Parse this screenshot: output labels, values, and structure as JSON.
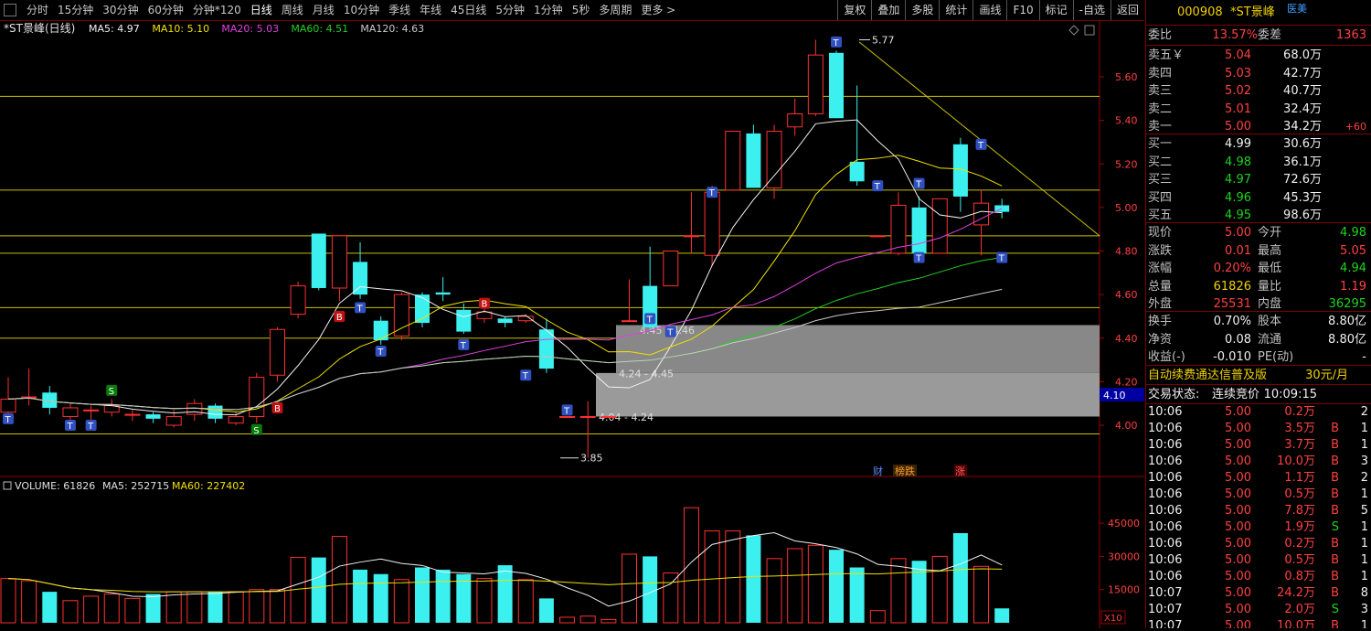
{
  "toolbar": {
    "tabs": [
      {
        "label": "分时",
        "active": false
      },
      {
        "label": "15分钟",
        "active": false
      },
      {
        "label": "30分钟",
        "active": false
      },
      {
        "label": "60分钟",
        "active": false
      },
      {
        "label": "分钟*120",
        "active": false
      },
      {
        "label": "日线",
        "active": true
      },
      {
        "label": "周线",
        "active": false
      },
      {
        "label": "月线",
        "active": false
      },
      {
        "label": "10分钟",
        "active": false
      },
      {
        "label": "季线",
        "active": false
      },
      {
        "label": "年线",
        "active": false
      },
      {
        "label": "45日线",
        "active": false
      },
      {
        "label": "5分钟",
        "active": false
      },
      {
        "label": "1分钟",
        "active": false
      },
      {
        "label": "5秒",
        "active": false
      },
      {
        "label": "多周期",
        "active": false
      },
      {
        "label": "更多 >",
        "active": false
      }
    ],
    "tools": [
      "复权",
      "叠加",
      "多股",
      "统计",
      "画线",
      "F10",
      "标记",
      "-自选",
      "返回"
    ]
  },
  "chart": {
    "title": "*ST景峰(日线)",
    "ma_labels": [
      {
        "text": "MA5: 4.97",
        "color": "#f0f0f0"
      },
      {
        "text": "MA10: 5.10",
        "color": "#f0e000"
      },
      {
        "text": "MA20: 5.03",
        "color": "#e040e0"
      },
      {
        "text": "MA60: 4.51",
        "color": "#20d020"
      },
      {
        "text": "MA120: 4.63",
        "color": "#c8c8c8"
      }
    ],
    "price_ticks": [
      "5.60",
      "5.40",
      "5.20",
      "5.00",
      "4.80",
      "4.60",
      "4.40",
      "4.20",
      "4.00"
    ],
    "current_price_tag": "4.10",
    "annotations": {
      "high": "5.77",
      "low": "3.85",
      "zone1": "4.45 - 4.46",
      "zone2": "4.24 - 4.45",
      "zone3": "4.04 - 4.24"
    },
    "markers": {
      "cai": "财",
      "bang": "榜跌",
      "zhang": "涨"
    },
    "signal_t": "T",
    "signal_b": "B",
    "signal_s": "S",
    "volume_title": "VOLUME: 61826",
    "volume_ma5": "MA5: 252715",
    "volume_ma60": "MA60: 227402",
    "volume_ticks": [
      "45000",
      "30000",
      "15000"
    ],
    "volume_unit": "X10",
    "colors": {
      "up": "#ff3030",
      "down": "#3cf0f0",
      "ma5": "#f0f0f0",
      "ma10": "#f0e000",
      "ma20": "#e040e0",
      "ma60": "#20d020",
      "ma120": "#c8c8c8",
      "zone": "#888888"
    }
  },
  "chart_data": {
    "type": "candlestick",
    "title": "*ST景峰(日线)",
    "candles": [
      {
        "o": 4.06,
        "c": 4.12,
        "h": 4.22,
        "l": 4.01
      },
      {
        "o": 4.13,
        "c": 4.13,
        "h": 4.26,
        "l": 4.09
      },
      {
        "o": 4.15,
        "c": 4.08,
        "h": 4.18,
        "l": 4.05
      },
      {
        "o": 4.04,
        "c": 4.08,
        "h": 4.1,
        "l": 4.0
      },
      {
        "o": 4.07,
        "c": 4.07,
        "h": 4.09,
        "l": 4.02
      },
      {
        "o": 4.06,
        "c": 4.09,
        "h": 4.12,
        "l": 4.04
      },
      {
        "o": 4.05,
        "c": 4.05,
        "h": 4.07,
        "l": 4.02
      },
      {
        "o": 4.05,
        "c": 4.03,
        "h": 4.06,
        "l": 4.01
      },
      {
        "o": 4.0,
        "c": 4.04,
        "h": 4.07,
        "l": 3.99
      },
      {
        "o": 4.05,
        "c": 4.1,
        "h": 4.12,
        "l": 4.02
      },
      {
        "o": 4.09,
        "c": 4.03,
        "h": 4.1,
        "l": 4.01
      },
      {
        "o": 4.01,
        "c": 4.04,
        "h": 4.06,
        "l": 4.0
      },
      {
        "o": 4.04,
        "c": 4.22,
        "h": 4.24,
        "l": 4.01
      },
      {
        "o": 4.23,
        "c": 4.44,
        "h": 4.45,
        "l": 4.2
      },
      {
        "o": 4.51,
        "c": 4.64,
        "h": 4.66,
        "l": 4.49
      },
      {
        "o": 4.88,
        "c": 4.63,
        "h": 4.88,
        "l": 4.62
      },
      {
        "o": 4.63,
        "c": 4.87,
        "h": 4.87,
        "l": 4.57
      },
      {
        "o": 4.75,
        "c": 4.6,
        "h": 4.84,
        "l": 4.58
      },
      {
        "o": 4.48,
        "c": 4.39,
        "h": 4.5,
        "l": 4.37
      },
      {
        "o": 4.41,
        "c": 4.6,
        "h": 4.61,
        "l": 4.39
      },
      {
        "o": 4.6,
        "c": 4.47,
        "h": 4.61,
        "l": 4.45
      },
      {
        "o": 4.61,
        "c": 4.6,
        "h": 4.68,
        "l": 4.57
      },
      {
        "o": 4.53,
        "c": 4.43,
        "h": 4.56,
        "l": 4.42
      },
      {
        "o": 4.49,
        "c": 4.52,
        "h": 4.54,
        "l": 4.47
      },
      {
        "o": 4.49,
        "c": 4.47,
        "h": 4.5,
        "l": 4.45
      },
      {
        "o": 4.48,
        "c": 4.5,
        "h": 4.51,
        "l": 4.47
      },
      {
        "o": 4.44,
        "c": 4.26,
        "h": 4.49,
        "l": 4.24
      },
      {
        "o": 4.04,
        "c": 4.04,
        "h": 4.04,
        "l": 4.04
      },
      {
        "o": 4.04,
        "c": 4.04,
        "h": 4.11,
        "l": 3.85
      },
      {
        "o": 4.04,
        "c": 4.04,
        "h": 4.04,
        "l": 4.04
      },
      {
        "o": 4.48,
        "c": 4.48,
        "h": 4.67,
        "l": 4.48
      },
      {
        "o": 4.64,
        "c": 4.45,
        "h": 4.82,
        "l": 4.43
      },
      {
        "o": 4.64,
        "c": 4.8,
        "h": 4.8,
        "l": 4.64
      },
      {
        "o": 4.87,
        "c": 4.87,
        "h": 5.07,
        "l": 4.79
      },
      {
        "o": 4.78,
        "c": 5.07,
        "h": 5.1,
        "l": 4.73
      },
      {
        "o": 5.08,
        "c": 5.35,
        "h": 5.35,
        "l": 5.08
      },
      {
        "o": 5.34,
        "c": 5.09,
        "h": 5.38,
        "l": 5.09
      },
      {
        "o": 5.09,
        "c": 5.35,
        "h": 5.38,
        "l": 5.04
      },
      {
        "o": 5.37,
        "c": 5.43,
        "h": 5.5,
        "l": 5.33
      },
      {
        "o": 5.43,
        "c": 5.7,
        "h": 5.77,
        "l": 5.42
      },
      {
        "o": 5.71,
        "c": 5.41,
        "h": 5.72,
        "l": 5.41
      },
      {
        "o": 5.21,
        "c": 5.12,
        "h": 5.56,
        "l": 5.1
      },
      {
        "o": 4.87,
        "c": 4.87,
        "h": 4.87,
        "l": 4.87
      },
      {
        "o": 4.79,
        "c": 5.01,
        "h": 5.07,
        "l": 4.78
      },
      {
        "o": 5.0,
        "c": 4.79,
        "h": 5.05,
        "l": 4.77
      },
      {
        "o": 4.79,
        "c": 5.04,
        "h": 5.04,
        "l": 4.79
      },
      {
        "o": 5.29,
        "c": 5.05,
        "h": 5.32,
        "l": 4.98
      },
      {
        "o": 4.92,
        "c": 5.02,
        "h": 5.08,
        "l": 4.78
      },
      {
        "o": 5.01,
        "c": 4.98,
        "h": 5.04,
        "l": 4.95
      }
    ],
    "volumes": [
      20000,
      19000,
      14000,
      10000,
      12000,
      13000,
      11000,
      13000,
      14000,
      14000,
      14000,
      14000,
      15000,
      15000,
      29500,
      29500,
      39000,
      24000,
      22000,
      19500,
      25000,
      24000,
      22000,
      20000,
      26000,
      19500,
      11000,
      2500,
      3000,
      1500,
      31000,
      30000,
      22500,
      52000,
      41500,
      41500,
      39500,
      29000,
      33500,
      35000,
      33000,
      25000,
      5500,
      29000,
      28000,
      30000,
      40500,
      25500,
      6500
    ],
    "ma_values": {
      "MA5": 4.97,
      "MA10": 5.1,
      "MA20": 5.03,
      "MA60": 4.51,
      "MA120": 4.63
    },
    "volume_ma": {
      "MA5": 252715,
      "MA60": 227402
    },
    "ylim": [
      3.85,
      5.77
    ]
  },
  "quote": {
    "code": "000908",
    "name": "*ST景峰",
    "tag": "医美",
    "weibi_label": "委比",
    "weibi": "13.57%",
    "weicha_label": "委差",
    "weicha": "1363",
    "sells": [
      {
        "label": "卖五￥",
        "price": "5.04",
        "vol": "68.0万",
        "chg": ""
      },
      {
        "label": "卖四",
        "price": "5.03",
        "vol": "42.7万",
        "chg": ""
      },
      {
        "label": "卖三",
        "price": "5.02",
        "vol": "40.7万",
        "chg": ""
      },
      {
        "label": "卖二",
        "price": "5.01",
        "vol": "32.4万",
        "chg": ""
      },
      {
        "label": "卖一",
        "price": "5.00",
        "vol": "34.2万",
        "chg": "+60"
      }
    ],
    "buys": [
      {
        "label": "买一",
        "price": "4.99",
        "vol": "30.6万",
        "pc": "white"
      },
      {
        "label": "买二",
        "price": "4.98",
        "vol": "36.1万",
        "pc": "green"
      },
      {
        "label": "买三",
        "price": "4.97",
        "vol": "72.6万",
        "pc": "green"
      },
      {
        "label": "买四",
        "price": "4.96",
        "vol": "45.3万",
        "pc": "green"
      },
      {
        "label": "买五",
        "price": "4.95",
        "vol": "98.6万",
        "pc": "green"
      }
    ],
    "stats": [
      {
        "l1": "现价",
        "v1": "5.00",
        "c1": "red",
        "l2": "今开",
        "v2": "4.98",
        "c2": "green"
      },
      {
        "l1": "涨跌",
        "v1": "0.01",
        "c1": "red",
        "l2": "最高",
        "v2": "5.05",
        "c2": "red"
      },
      {
        "l1": "涨幅",
        "v1": "0.20%",
        "c1": "red",
        "l2": "最低",
        "v2": "4.94",
        "c2": "green"
      },
      {
        "l1": "总量",
        "v1": "61826",
        "c1": "yellow",
        "l2": "量比",
        "v2": "1.19",
        "c2": "red"
      },
      {
        "l1": "外盘",
        "v1": "25531",
        "c1": "red",
        "l2": "内盘",
        "v2": "36295",
        "c2": "green"
      }
    ],
    "stats2": [
      {
        "l1": "换手",
        "v1": "0.70%",
        "l2": "股本",
        "v2": "8.80亿"
      },
      {
        "l1": "净资",
        "v1": "0.08",
        "l2": "流通",
        "v2": "8.80亿"
      },
      {
        "l1": "收益(-)",
        "v1": "-0.010",
        "l2": "PE(动)",
        "v2": "-"
      }
    ],
    "subscribe": "自动续费通达信普及版",
    "price": "30元/月",
    "status_label": "交易状态:",
    "status": "连续竞价",
    "status_time": "10:09:15",
    "ticks": [
      {
        "t": "10:06",
        "p": "5.00",
        "v": "0.2万",
        "d": "",
        "n": "2"
      },
      {
        "t": "10:06",
        "p": "5.00",
        "v": "3.5万",
        "d": "B",
        "n": "1"
      },
      {
        "t": "10:06",
        "p": "5.00",
        "v": "3.7万",
        "d": "B",
        "n": "1"
      },
      {
        "t": "10:06",
        "p": "5.00",
        "v": "10.0万",
        "d": "B",
        "n": "3"
      },
      {
        "t": "10:06",
        "p": "5.00",
        "v": "1.1万",
        "d": "B",
        "n": "2"
      },
      {
        "t": "10:06",
        "p": "5.00",
        "v": "0.5万",
        "d": "B",
        "n": "1"
      },
      {
        "t": "10:06",
        "p": "5.00",
        "v": "7.8万",
        "d": "B",
        "n": "5"
      },
      {
        "t": "10:06",
        "p": "5.00",
        "v": "1.9万",
        "d": "S",
        "n": "1"
      },
      {
        "t": "10:06",
        "p": "5.00",
        "v": "0.2万",
        "d": "B",
        "n": "1"
      },
      {
        "t": "10:06",
        "p": "5.00",
        "v": "0.5万",
        "d": "B",
        "n": "1"
      },
      {
        "t": "10:06",
        "p": "5.00",
        "v": "0.8万",
        "d": "B",
        "n": "1"
      },
      {
        "t": "10:07",
        "p": "5.00",
        "v": "24.2万",
        "d": "B",
        "n": "8"
      },
      {
        "t": "10:07",
        "p": "5.00",
        "v": "2.0万",
        "d": "S",
        "n": "3"
      },
      {
        "t": "10:07",
        "p": "5.00",
        "v": "10.0万",
        "d": "B",
        "n": "1"
      }
    ]
  }
}
